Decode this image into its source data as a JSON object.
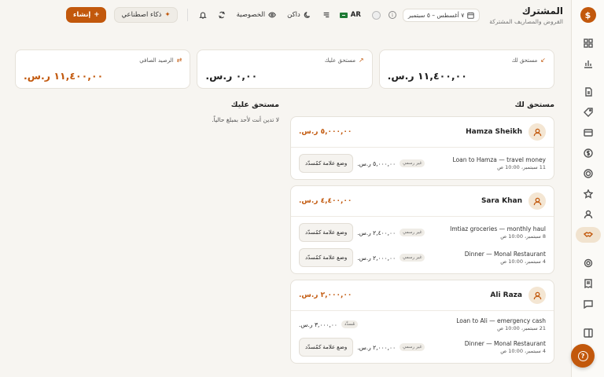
{
  "header": {
    "title": "المشترك",
    "subtitle": "القروض والمصاريف المشتركة",
    "date_range": "٧ أغسطس – ٥ سبتمبر",
    "lang_label": "AR",
    "theme_label": "داكن",
    "privacy_label": "الخصوصية",
    "ai_label": "ذكاء اصطناعي",
    "create_label": "إنشاء"
  },
  "summary": {
    "owed_to_you_label": "مستحق لك",
    "owed_to_you_value": "١١,٤٠٠,٠٠ ر.س.",
    "you_owe_label": "مستحق عليك",
    "you_owe_value": "٠,٠٠ ر.س.",
    "net_label": "الرصيد الصافي",
    "net_value": "١١,٤٠٠,٠٠ ر.س."
  },
  "owed_to_you": {
    "title": "مستحق لك",
    "people": [
      {
        "name": "Hamza Sheikh",
        "total": "٥,٠٠٠,٠٠ ر.س.",
        "txns": [
          {
            "title": "Loan to Hamza — travel money",
            "date": "11 سبتمبر، 10:00 ص",
            "badge": "غير رسمي",
            "amount": "٥,٠٠٠,٠٠ ر.س.",
            "action": "وضع علامة كمُسدّد"
          }
        ]
      },
      {
        "name": "Sara Khan",
        "total": "٤,٤٠٠,٠٠ ر.س.",
        "txns": [
          {
            "title": "Imtiaz groceries — monthly haul",
            "date": "8 سبتمبر، 10:00 ص",
            "badge": "غير رسمي",
            "amount": "٢,٤٠٠,٠٠ ر.س.",
            "action": "وضع علامة كمُسدّد"
          },
          {
            "title": "Dinner — Monal Restaurant",
            "date": "4 سبتمبر، 10:00 ص",
            "badge": "غير رسمي",
            "amount": "٢,٠٠٠,٠٠ ر.س.",
            "action": "وضع علامة كمُسدّد"
          }
        ]
      },
      {
        "name": "Ali Raza",
        "total": "٢,٠٠٠,٠٠ ر.س.",
        "txns": [
          {
            "title": "Loan to Ali — emergency cash",
            "date": "21 سبتمبر، 10:00 ص",
            "badge": "مُسدَّد",
            "amount": "٣,٠٠٠,٠٠ ر.س.",
            "action": ""
          },
          {
            "title": "Dinner — Monal Restaurant",
            "date": "4 سبتمبر، 10:00 ص",
            "badge": "غير رسمي",
            "amount": "٢,٠٠٠,٠٠ ر.س.",
            "action": "وضع علامة كمُسدّد"
          }
        ]
      }
    ]
  },
  "you_owe": {
    "title": "مستحق عليك",
    "empty_text": "لا تدين أنت لأحد بمبلغ حالياً."
  },
  "colors": {
    "accent": "#c2580c",
    "background": "#f7f5f1"
  }
}
